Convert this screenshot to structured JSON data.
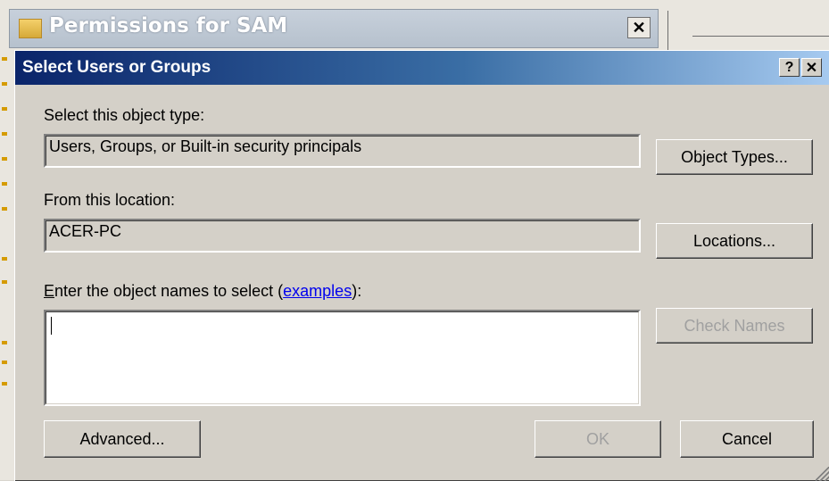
{
  "background_window": {
    "title": "Permissions for SAM",
    "close_glyph": "✕"
  },
  "dialog": {
    "title": "Select Users or Groups",
    "help_glyph": "?",
    "close_glyph": "✕",
    "object_type": {
      "label": "Select this object type:",
      "value": "Users, Groups, or Built-in security principals",
      "button": "Object Types..."
    },
    "location": {
      "label": "From this location:",
      "value": "ACER-PC",
      "button": "Locations..."
    },
    "names": {
      "label_prefix": "E",
      "label_rest": "nter the object names to select (",
      "link": "examples",
      "label_suffix": "):",
      "value": "",
      "check_button": "Check Names"
    },
    "buttons": {
      "advanced": "Advanced...",
      "ok": "OK",
      "cancel": "Cancel"
    }
  },
  "colors": {
    "titlebar_start": "#0a246a",
    "titlebar_end": "#a6caf0",
    "link": "#0000ee"
  }
}
